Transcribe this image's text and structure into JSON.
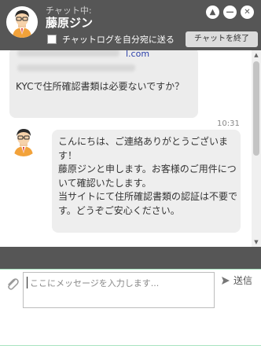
{
  "header": {
    "subtitle": "チャット中:",
    "operator_name": "藤原ジン",
    "minimize_label": "—",
    "close_label": "✕",
    "up_label": "▲",
    "checkbox_label": "チャットログを自分宛に送る",
    "end_chat_label": "チャットを終了"
  },
  "messages": [
    {
      "sender": "user",
      "email_visible": "l.com",
      "text": "KYCで住所確認書類は必要ないですか？"
    },
    {
      "sender": "agent",
      "time": "10:31",
      "text": "こんにちは、ご連絡ありがとうございます！\n藤原ジンと申します。お客様のご用件について確認いたします。\n当サイトにて住所確認書類の認証は不要です。どうぞご安心ください。"
    }
  ],
  "input": {
    "placeholder": "ここにメッセージを入力します..."
  },
  "send_label": "送信",
  "icons": {
    "attach": "paperclip-icon",
    "send": "send-arrow-icon"
  }
}
